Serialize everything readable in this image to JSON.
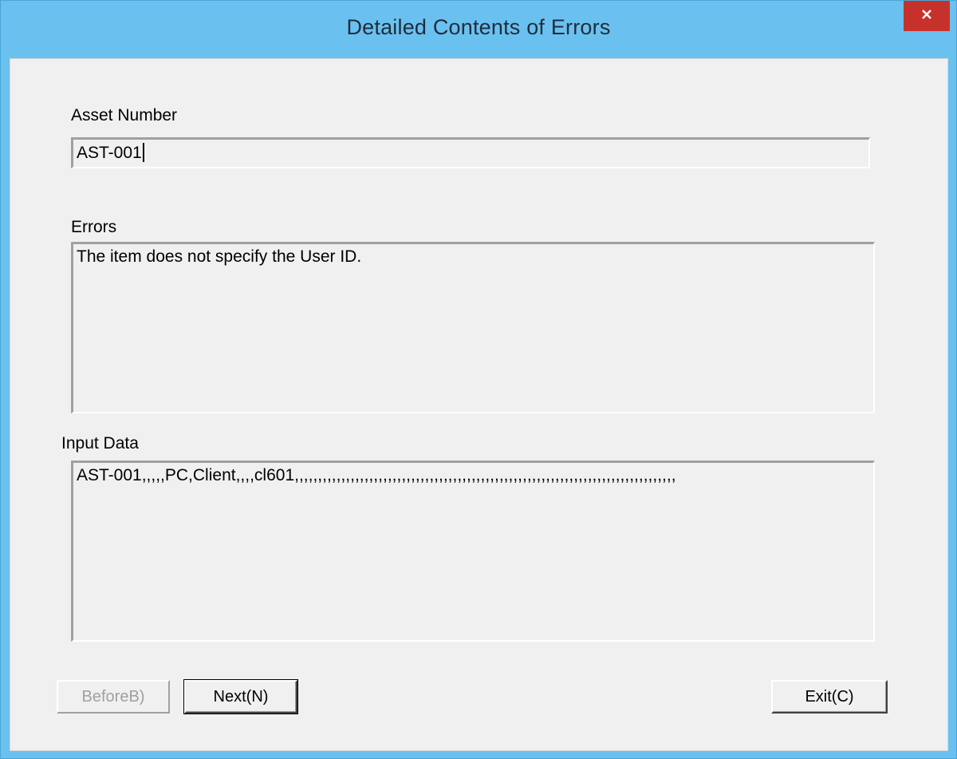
{
  "window": {
    "title": "Detailed Contents of Errors"
  },
  "form": {
    "asset_number_label": "Asset Number",
    "asset_number_value": "AST-001",
    "errors_label": "Errors",
    "errors_value": "The item does not specify the User ID.",
    "input_data_label": "Input Data",
    "input_data_value": "AST-001,,,,,PC,Client,,,,cl601,,,,,,,,,,,,,,,,,,,,,,,,,,,,,,,,,,,,,,,,,,,,,,,,,,,,,,,,,,,,,,,,,,,,,,,,,,,,,,,,,,"
  },
  "buttons": {
    "before_label": "BeforeB)",
    "next_label": "Next(N)",
    "exit_label": "Exit(C)"
  },
  "icons": {
    "close": "close-icon"
  },
  "colors": {
    "titlebar": "#6ac1f0",
    "close_button": "#c7312c",
    "client_background": "#f0f0f0"
  }
}
